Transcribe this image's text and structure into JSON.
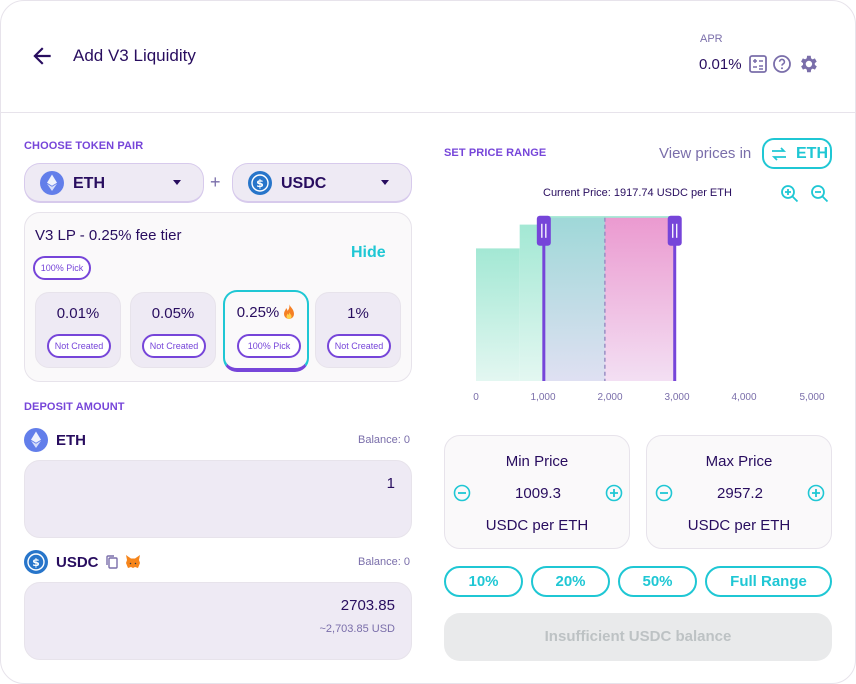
{
  "header": {
    "title": "Add V3 Liquidity",
    "apr_label": "APR",
    "apr_value": "0.01%"
  },
  "token_pair": {
    "label": "CHOOSE TOKEN PAIR",
    "token_a": "ETH",
    "token_b": "USDC",
    "plus": "+"
  },
  "fee": {
    "title": "V3 LP - 0.25% fee tier",
    "pick_badge": "100% Pick",
    "hide_label": "Hide",
    "options": [
      {
        "pct": "0.01%",
        "status": "Not Created",
        "selected": false
      },
      {
        "pct": "0.05%",
        "status": "Not Created",
        "selected": false
      },
      {
        "pct": "0.25%",
        "status": "100% Pick",
        "selected": true
      },
      {
        "pct": "1%",
        "status": "Not Created",
        "selected": false
      }
    ]
  },
  "deposit": {
    "label": "DEPOSIT AMOUNT",
    "eth": {
      "name": "ETH",
      "balance": "Balance: 0",
      "amount": "1"
    },
    "usdc": {
      "name": "USDC",
      "balance": "Balance: 0",
      "amount": "2703.85",
      "usd": "~2,703.85 USD"
    }
  },
  "price_range": {
    "label": "SET PRICE RANGE",
    "view_label": "View prices in",
    "view_token": "ETH",
    "current_price": "Current Price: 1917.74 USDC per ETH",
    "min": {
      "title": "Min Price",
      "value": "1009.3",
      "unit": "USDC per ETH"
    },
    "max": {
      "title": "Max Price",
      "value": "2957.2",
      "unit": "USDC per ETH"
    },
    "presets": [
      "10%",
      "20%",
      "50%",
      "Full Range"
    ],
    "submit_label": "Insufficient USDC balance"
  },
  "chart_data": {
    "type": "area",
    "x_ticks": [
      "0",
      "1,000",
      "2,000",
      "3,000",
      "4,000",
      "5,000"
    ],
    "xlim": [
      0,
      5000
    ],
    "current_price": 1917.74,
    "range_min": 1009.3,
    "range_max": 2957.2,
    "liquidity_steps": [
      {
        "from": 0,
        "to": 650,
        "level": 0.78
      },
      {
        "from": 650,
        "to": 1000,
        "level": 0.92
      },
      {
        "from": 1000,
        "to": 2957,
        "level": 0.97
      }
    ]
  },
  "colors": {
    "primary": "#7645d9",
    "accent": "#1fc7d4",
    "text": "#280d5f",
    "muted": "#7a6eaa",
    "range_left": "#a7e5e4",
    "range_right": "#ec9bd2"
  }
}
